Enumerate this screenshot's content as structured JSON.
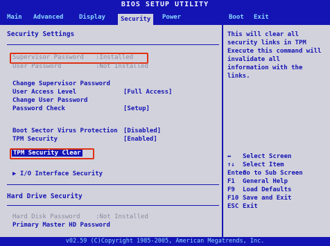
{
  "title": "BIOS SETUP UTILITY",
  "menu": [
    "Main",
    "Advanced",
    "Display",
    "Security",
    "Power",
    "Boot",
    "Exit"
  ],
  "active_menu": "Security",
  "main": {
    "heading": "Security Settings",
    "supervisor_password": {
      "label": "Supervisor Password",
      "value": ":Installed"
    },
    "user_password": {
      "label": "User Password",
      "value": ":Not Installed"
    },
    "change_supervisor": "Change Supervisor Password",
    "user_access_level": {
      "label": "User Access Level",
      "value": "[Full Access]"
    },
    "change_user": "Change User Password",
    "password_check": {
      "label": "Password Check",
      "value": "[Setup]"
    },
    "boot_sector": {
      "label": "Boot Sector Virus Protection",
      "value": "[Disabled]"
    },
    "tpm_security": {
      "label": "TPM Security",
      "value": "[Enabled]"
    },
    "tpm_clear": "TPM Security Clear",
    "io_interface": "▶ I/O Interface Security",
    "hdd_heading": "Hard Drive Security",
    "hdd_password": {
      "label": "Hard Disk Password",
      "value": ":Not Installed"
    },
    "primary_master": "Primary Master HD Password"
  },
  "help": {
    "description": "This will clear all security links in TPM Execute this command will invalidate all information with the links.",
    "keys": [
      {
        "key": "↔",
        "action": "Select Screen"
      },
      {
        "key": "↑↓",
        "action": "Select Item"
      },
      {
        "key": "Enter",
        "action": "Go to Sub Screen"
      },
      {
        "key": "F1",
        "action": "General Help"
      },
      {
        "key": "F9",
        "action": "Load Defaults"
      },
      {
        "key": "F10",
        "action": "Save and Exit"
      },
      {
        "key": "ESC",
        "action": "Exit"
      }
    ]
  },
  "footer": "v02.59 (C)Copyright 1985-2005, American Megatrends, Inc.",
  "colors": {
    "bios_blue": "#1414b4",
    "panel": "#d2d2dc",
    "highlight": "#e03010"
  }
}
